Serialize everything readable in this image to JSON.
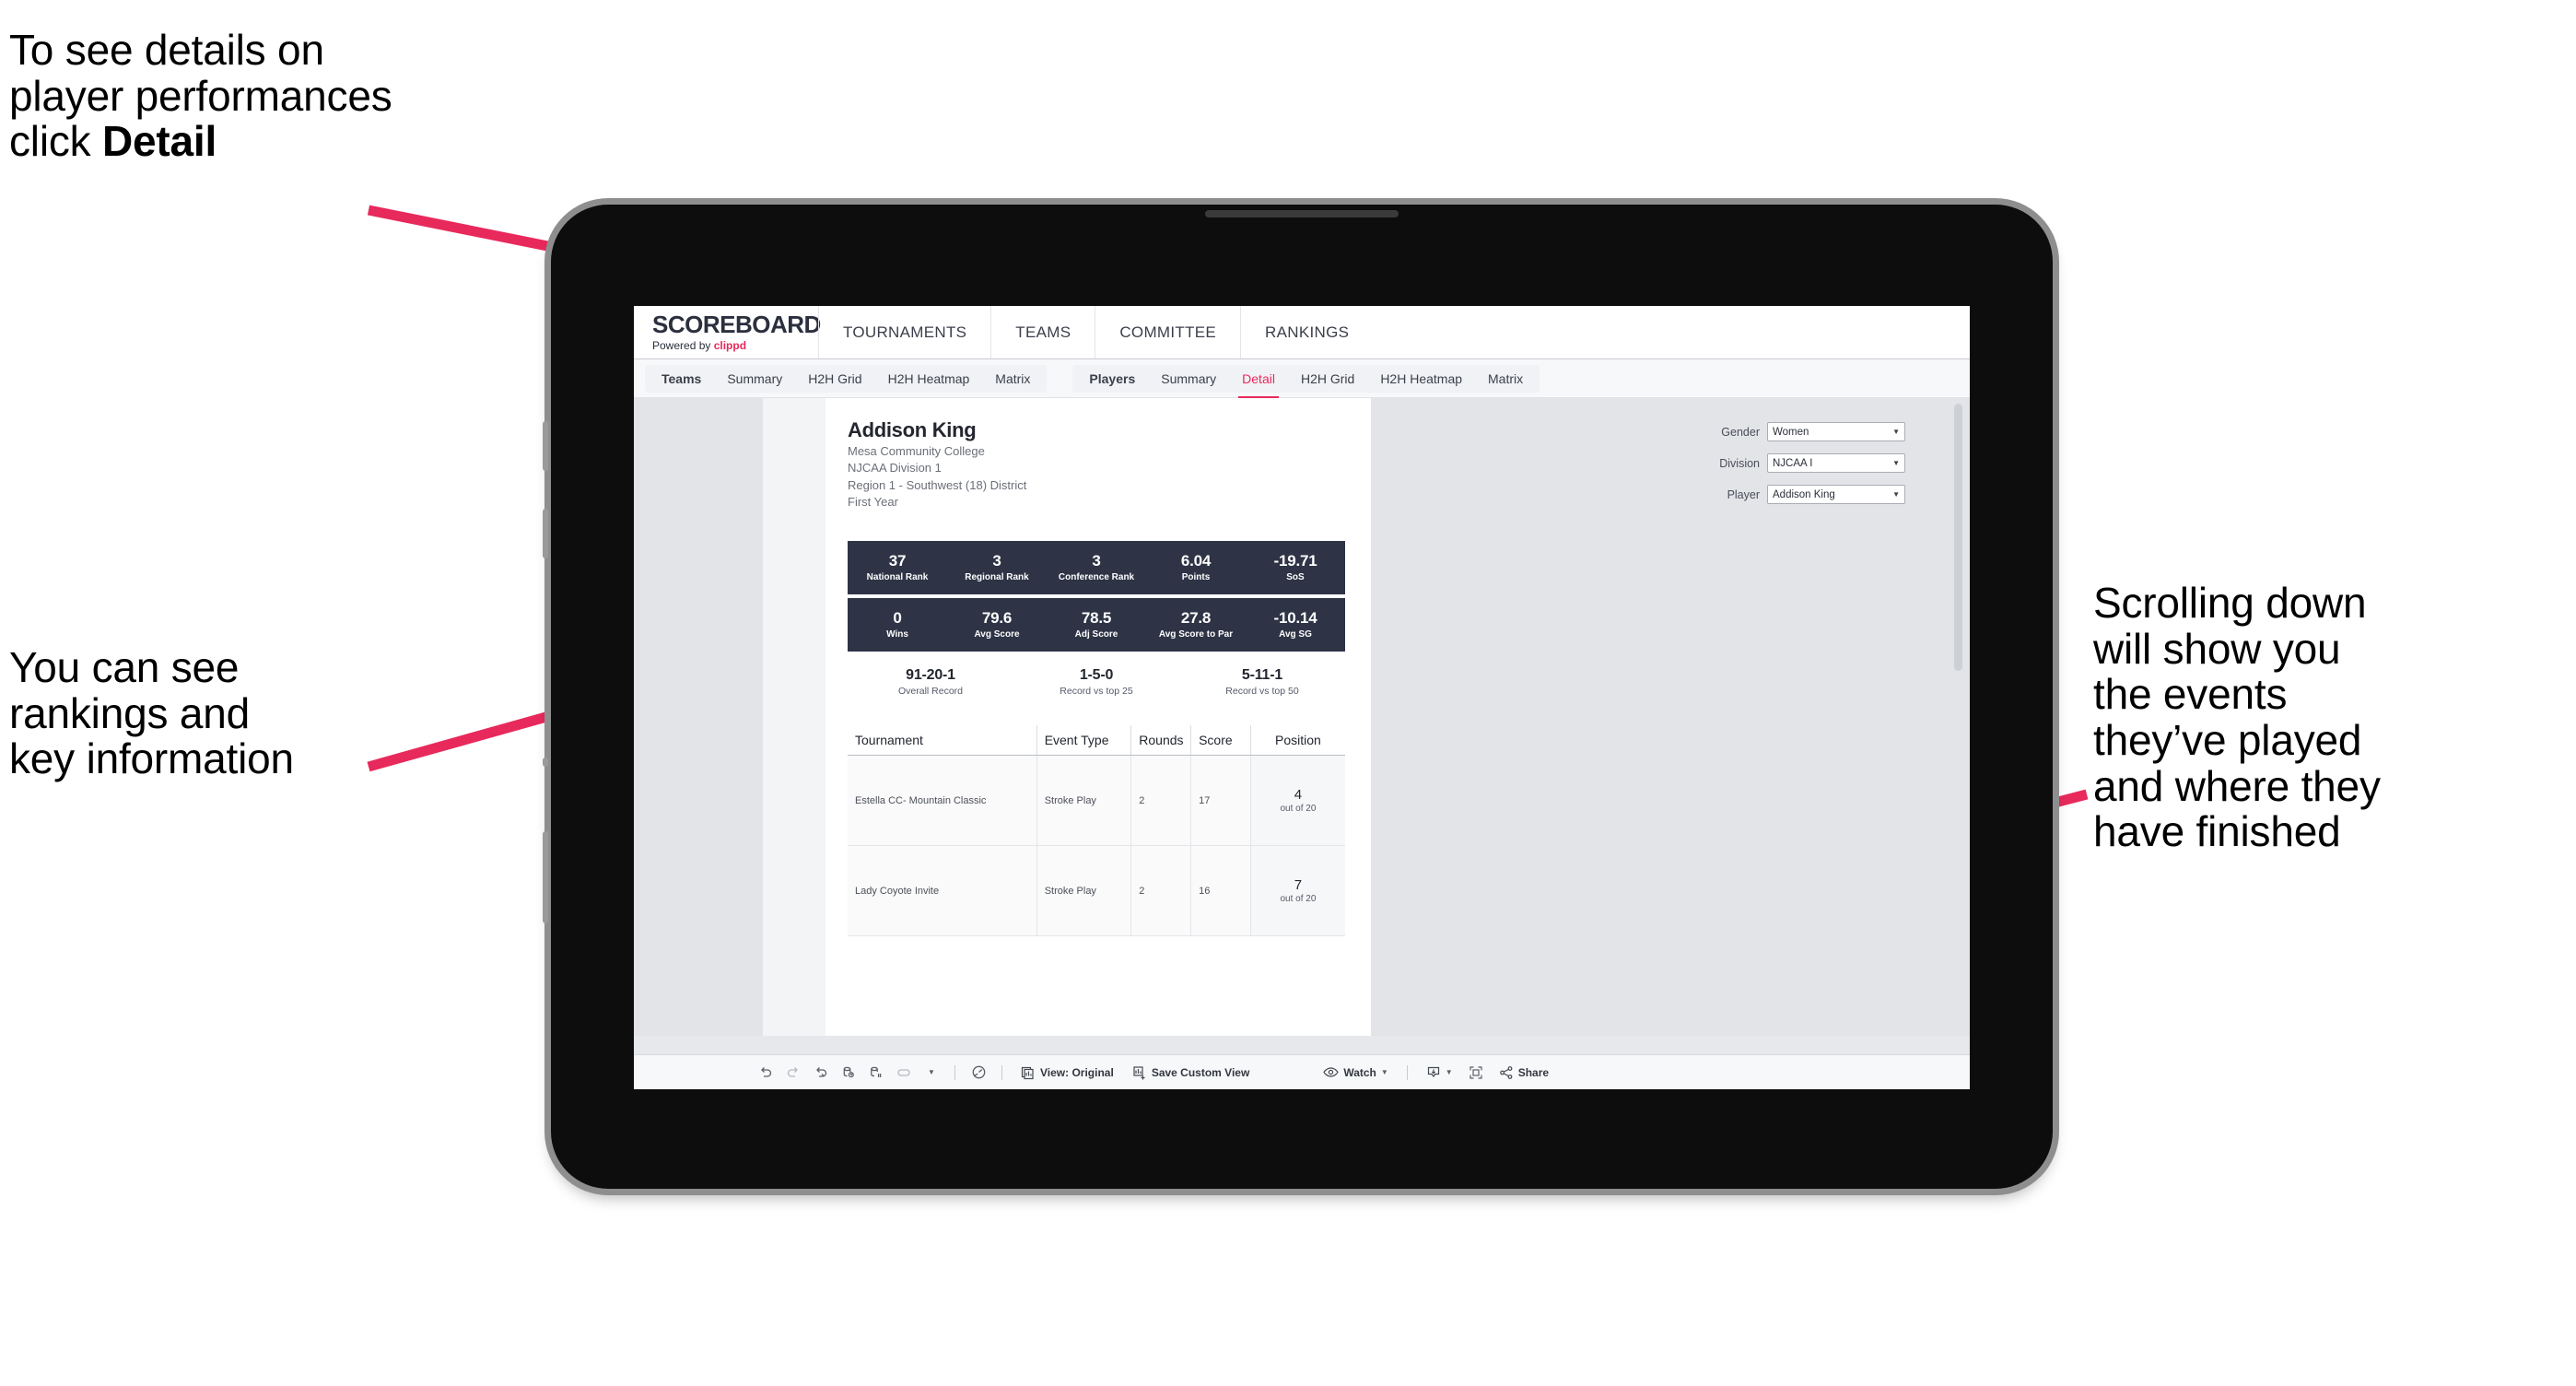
{
  "annotations": {
    "top_left": {
      "line1": "To see details on",
      "line2": "player performances",
      "line3_prefix": "click ",
      "line3_bold": "Detail"
    },
    "mid_left": {
      "line1": "You can see",
      "line2": "rankings and",
      "line3": "key information"
    },
    "right": {
      "line1": "Scrolling down",
      "line2": "will show you",
      "line3": "the events",
      "line4": "they’ve played",
      "line5": "and where they",
      "line6": "have finished"
    }
  },
  "accent_color": "#e8295c",
  "app": {
    "brand": {
      "logo": "SCOREBOARD",
      "powered_prefix": "Powered by ",
      "powered_name": "clippd"
    },
    "main_nav": [
      "TOURNAMENTS",
      "TEAMS",
      "COMMITTEE",
      "RANKINGS"
    ],
    "sub_nav": {
      "teams_group": [
        "Teams",
        "Summary",
        "H2H Grid",
        "H2H Heatmap",
        "Matrix"
      ],
      "players_group": [
        "Players",
        "Summary",
        "Detail",
        "H2H Grid",
        "H2H Heatmap",
        "Matrix"
      ],
      "active": "Detail"
    }
  },
  "player": {
    "name": "Addison King",
    "school": "Mesa Community College",
    "division": "NJCAA Division 1",
    "region": "Region 1 - Southwest (18) District",
    "year": "First Year"
  },
  "filters": [
    {
      "label": "Gender",
      "value": "Women"
    },
    {
      "label": "Division",
      "value": "NJCAA I"
    },
    {
      "label": "Player",
      "value": "Addison King"
    }
  ],
  "stats_row1": [
    {
      "value": "37",
      "label": "National Rank"
    },
    {
      "value": "3",
      "label": "Regional Rank"
    },
    {
      "value": "3",
      "label": "Conference Rank"
    },
    {
      "value": "6.04",
      "label": "Points"
    },
    {
      "value": "-19.71",
      "label": "SoS"
    }
  ],
  "stats_row2": [
    {
      "value": "0",
      "label": "Wins"
    },
    {
      "value": "79.6",
      "label": "Avg Score"
    },
    {
      "value": "78.5",
      "label": "Adj Score"
    },
    {
      "value": "27.8",
      "label": "Avg Score to Par"
    },
    {
      "value": "-10.14",
      "label": "Avg SG"
    }
  ],
  "records": [
    {
      "value": "91-20-1",
      "label": "Overall Record"
    },
    {
      "value": "1-5-0",
      "label": "Record vs top 25"
    },
    {
      "value": "5-11-1",
      "label": "Record vs top 50"
    }
  ],
  "events_table": {
    "columns": [
      "Tournament",
      "Event Type",
      "Rounds",
      "Score",
      "Position"
    ],
    "rows": [
      {
        "tournament": "Estella CC- Mountain Classic",
        "event_type": "Stroke Play",
        "rounds": "2",
        "score": "17",
        "position": "4",
        "position_out_of": "out of 20"
      },
      {
        "tournament": "Lady Coyote Invite",
        "event_type": "Stroke Play",
        "rounds": "2",
        "score": "16",
        "position": "7",
        "position_out_of": "out of 20"
      }
    ]
  },
  "toolbar": {
    "view_label": "View: Original",
    "save_label": "Save Custom View",
    "watch_label": "Watch",
    "share_label": "Share"
  }
}
